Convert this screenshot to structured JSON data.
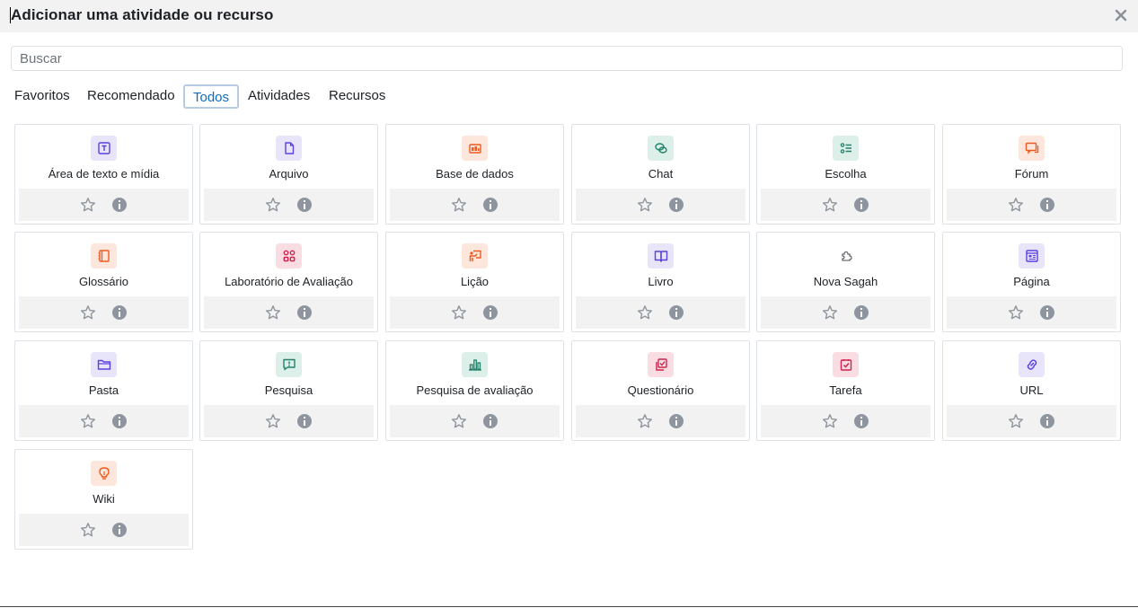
{
  "dialog": {
    "title": "Adicionar uma atividade ou recurso",
    "search_placeholder": "Buscar",
    "search_value": ""
  },
  "tabs": [
    {
      "label": "Favoritos",
      "active": false
    },
    {
      "label": "Recomendado",
      "active": false
    },
    {
      "label": "Todos",
      "active": true
    },
    {
      "label": "Atividades",
      "active": false
    },
    {
      "label": "Recursos",
      "active": false
    }
  ],
  "colors": {
    "accent": "#0f6cbf",
    "purple_bg": "#e8e5fb",
    "purple_fg": "#5b40e0",
    "orange_bg": "#fde6dc",
    "orange_fg": "#ef5a1f",
    "teal_bg": "#dcefe9",
    "teal_fg": "#23826c",
    "pink_bg": "#fadde3",
    "pink_fg": "#d0234d"
  },
  "modules": [
    {
      "name": "Área de texto e mídia",
      "icon": "text-media-icon",
      "color": "purple"
    },
    {
      "name": "Arquivo",
      "icon": "file-icon",
      "color": "purple"
    },
    {
      "name": "Base de dados",
      "icon": "database-icon",
      "color": "orange"
    },
    {
      "name": "Chat",
      "icon": "chat-icon",
      "color": "teal"
    },
    {
      "name": "Escolha",
      "icon": "choice-icon",
      "color": "teal"
    },
    {
      "name": "Fórum",
      "icon": "forum-icon",
      "color": "orange"
    },
    {
      "name": "Glossário",
      "icon": "glossary-icon",
      "color": "orange"
    },
    {
      "name": "Laboratório de Avaliação",
      "icon": "workshop-icon",
      "color": "pink"
    },
    {
      "name": "Lição",
      "icon": "lesson-icon",
      "color": "orange"
    },
    {
      "name": "Livro",
      "icon": "book-icon",
      "color": "purple"
    },
    {
      "name": "Nova Sagah",
      "icon": "puzzle-icon",
      "color": "none"
    },
    {
      "name": "Página",
      "icon": "page-icon",
      "color": "purple"
    },
    {
      "name": "Pasta",
      "icon": "folder-icon",
      "color": "purple"
    },
    {
      "name": "Pesquisa",
      "icon": "survey-icon",
      "color": "teal"
    },
    {
      "name": "Pesquisa de avaliação",
      "icon": "feedback-chart-icon",
      "color": "teal"
    },
    {
      "name": "Questionário",
      "icon": "quiz-icon",
      "color": "pink"
    },
    {
      "name": "Tarefa",
      "icon": "assignment-icon",
      "color": "pink"
    },
    {
      "name": "URL",
      "icon": "link-icon",
      "color": "purple"
    },
    {
      "name": "Wiki",
      "icon": "lightbulb-icon",
      "color": "orange"
    }
  ]
}
